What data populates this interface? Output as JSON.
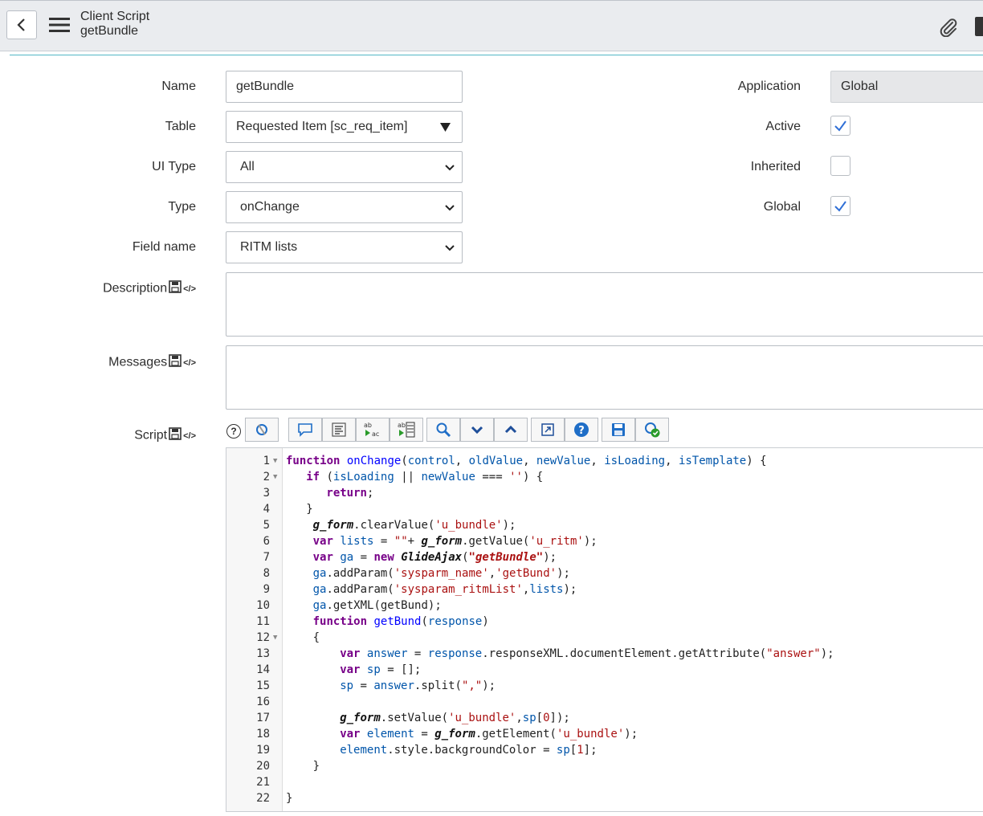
{
  "header": {
    "title": "Client Script",
    "subtitle": "getBundle"
  },
  "form": {
    "name_label": "Name",
    "name_value": "getBundle",
    "table_label": "Table",
    "table_value": "Requested Item [sc_req_item]",
    "ui_type_label": "UI Type",
    "ui_type_value": "All",
    "type_label": "Type",
    "type_value": "onChange",
    "field_name_label": "Field name",
    "field_name_value": "RITM lists",
    "description_label": "Description",
    "messages_label": "Messages",
    "script_label": "Script",
    "application_label": "Application",
    "application_value": "Global",
    "active_label": "Active",
    "active_checked": true,
    "inherited_label": "Inherited",
    "inherited_checked": false,
    "global_label": "Global",
    "global_checked": true
  },
  "toolbar": {
    "help_icon": "?",
    "buttons": [
      "toggle-syntax-icon",
      "comment-icon",
      "format-icon",
      "replace-icon",
      "replace-all-icon",
      "search-icon",
      "next-icon",
      "previous-icon",
      "fullscreen-icon",
      "help-icon",
      "save-icon",
      "check-syntax-icon"
    ]
  },
  "script_lines": [
    {
      "n": "1",
      "fold": true
    },
    {
      "n": "2",
      "fold": true
    },
    {
      "n": "3"
    },
    {
      "n": "4"
    },
    {
      "n": "5"
    },
    {
      "n": "6"
    },
    {
      "n": "7"
    },
    {
      "n": "8"
    },
    {
      "n": "9"
    },
    {
      "n": "10"
    },
    {
      "n": "11"
    },
    {
      "n": "12",
      "fold": true
    },
    {
      "n": "13"
    },
    {
      "n": "14"
    },
    {
      "n": "15"
    },
    {
      "n": "16"
    },
    {
      "n": "17"
    },
    {
      "n": "18"
    },
    {
      "n": "19"
    },
    {
      "n": "20"
    },
    {
      "n": "21"
    },
    {
      "n": "22"
    }
  ],
  "code": {
    "l1": [
      "function",
      " ",
      "onChange",
      "(",
      "control",
      ", ",
      "oldValue",
      ", ",
      "newValue",
      ", ",
      "isLoading",
      ", ",
      "isTemplate",
      ") {"
    ],
    "l2": [
      "if",
      " (",
      "isLoading",
      " || ",
      "newValue",
      " === ",
      "''",
      ") {"
    ],
    "l3": [
      "return",
      ";"
    ],
    "l4": "}",
    "l5": [
      "g_form",
      ".clearValue(",
      "'u_bundle'",
      ");"
    ],
    "l6": [
      "var",
      " ",
      "lists",
      " = ",
      "\"\"",
      "+ ",
      "g_form",
      ".getValue(",
      "'u_ritm'",
      ");"
    ],
    "l7": [
      "var",
      " ",
      "ga",
      " = ",
      "new",
      " ",
      "GlideAjax",
      "(",
      "\"getBundle\"",
      ");"
    ],
    "l8": [
      "ga",
      ".addParam(",
      "'sysparm_name'",
      ",",
      "'getBund'",
      ");"
    ],
    "l9": [
      "ga",
      ".addParam(",
      "'sysparam_ritmList'",
      ",",
      "lists",
      ");"
    ],
    "l10": [
      "ga",
      ".getXML(getBund);"
    ],
    "l11": [
      "function",
      " ",
      "getBund",
      "(",
      "response",
      ")"
    ],
    "l12": "{",
    "l13": [
      "var",
      " ",
      "answer",
      " = ",
      "response",
      ".responseXML.documentElement.getAttribute(",
      "\"answer\"",
      ");"
    ],
    "l14": [
      "var",
      " ",
      "sp",
      " = [];"
    ],
    "l15": [
      "sp",
      " = ",
      "answer",
      ".split(",
      "\",\"",
      ");"
    ],
    "l16": "",
    "l17": [
      "g_form",
      ".setValue(",
      "'u_bundle'",
      ",",
      "sp",
      "[",
      "0",
      "]);"
    ],
    "l18": [
      "var",
      " ",
      "element",
      " = ",
      "g_form",
      ".getElement(",
      "'u_bundle'",
      ");"
    ],
    "l19": [
      "element",
      ".style.backgroundColor = ",
      "sp",
      "[",
      "1",
      "];"
    ],
    "l20": "}",
    "l21": "",
    "l22": "}"
  }
}
